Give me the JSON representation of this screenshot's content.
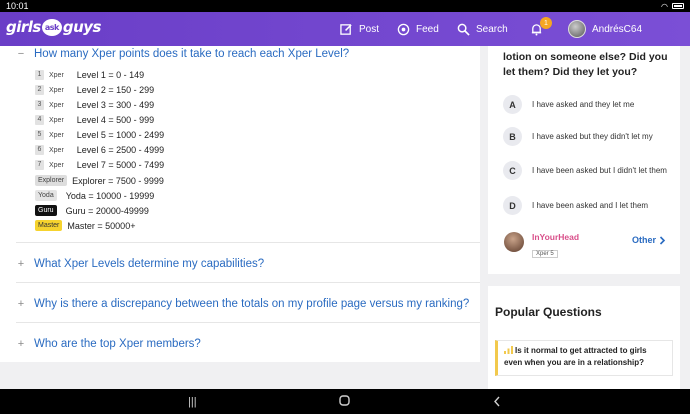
{
  "status": {
    "time": "10:01"
  },
  "topbar": {
    "logo": {
      "left": "girls",
      "mid": "ask",
      "right": "guys"
    },
    "post": "Post",
    "feed": "Feed",
    "search": "Search",
    "notification_count": "1",
    "username": "AndrésC64"
  },
  "faq": {
    "open_question": "How many Xper points does it take to reach each Xper Level?",
    "levels": [
      {
        "num": "1",
        "tag": "Xper",
        "text": "Level 1 = 0 - 149"
      },
      {
        "num": "2",
        "tag": "Xper",
        "text": "Level 2 = 150 - 299"
      },
      {
        "num": "3",
        "tag": "Xper",
        "text": "Level 3 = 300 - 499"
      },
      {
        "num": "4",
        "tag": "Xper",
        "text": "Level 4 = 500 - 999"
      },
      {
        "num": "5",
        "tag": "Xper",
        "text": "Level 5 = 1000 - 2499"
      },
      {
        "num": "6",
        "tag": "Xper",
        "text": "Level 6 = 2500 - 4999"
      },
      {
        "num": "7",
        "tag": "Xper",
        "text": "Level 7 = 5000 - 7499"
      }
    ],
    "special_levels": [
      {
        "badge": "Explorer",
        "text": "Explorer = 7500 - 9999"
      },
      {
        "badge": "Yoda",
        "text": "Yoda = 10000 - 19999"
      },
      {
        "badge": "Guru",
        "text": "Guru = 20000-49999"
      },
      {
        "badge": "Master",
        "text": "Master = 50000+"
      }
    ],
    "collapsed_questions": [
      "What Xper Levels determine my capabilities?",
      "Why is there a discrepancy between the totals on my profile page versus my ranking?",
      "Who are the top Xper members?"
    ],
    "toggle_open": "−",
    "toggle_closed": "+"
  },
  "poll": {
    "title": "lotion on someone else? Did you let them? Did they let you?",
    "options": [
      {
        "letter": "A",
        "text": "I have asked and they let me"
      },
      {
        "letter": "B",
        "text": "I have asked but they didn't let my"
      },
      {
        "letter": "C",
        "text": "I have been asked but I didn't let them"
      },
      {
        "letter": "D",
        "text": "I have been asked and I let them"
      }
    ],
    "author": "InYourHead",
    "author_tag": "Xper",
    "author_level": "5",
    "other": "Other"
  },
  "popular": {
    "title": "Popular Questions",
    "item": "Is it normal to get attracted to girls even when you are in a relationship?"
  },
  "colors": {
    "brand": "#6a3ec7",
    "link": "#2a6bc1",
    "author": "#d94f8a",
    "badge": "#f5a623"
  }
}
